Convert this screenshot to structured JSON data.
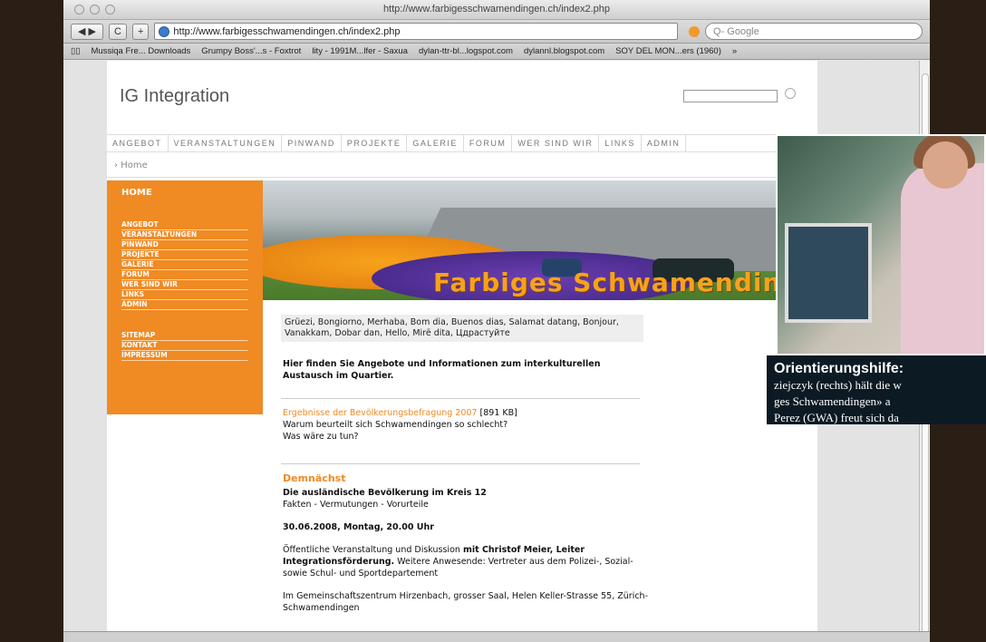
{
  "browser": {
    "window_title": "http://www.farbigesschwamendingen.ch/index2.php",
    "url": "http://www.farbigesschwamendingen.ch/index2.php",
    "search_placeholder": "Q- Google",
    "reload_label": "C",
    "add_label": "+",
    "bookmarks": [
      "Mussiqa Fre... Downloads",
      "Grumpy Boss'...s - Foxtrot",
      "lity - 1991M...lfer - Saxua",
      "dylan-ttr-bl...logspot.com",
      "dylannl.blogspot.com",
      "SOY DEL MON...ers (1960)"
    ],
    "bookmarks_more": "»"
  },
  "site": {
    "logo": "IG Integration",
    "nav": [
      "ANGEBOT",
      "VERANSTALTUNGEN",
      "PINWAND",
      "PROJEKTE",
      "GALERIE",
      "FORUM",
      "WER SIND WIR",
      "LINKS",
      "ADMIN"
    ],
    "breadcrumb": "Home",
    "sidebar_home": "HOME",
    "sidebar_items": [
      "ANGEBOT",
      "VERANSTALTUNGEN",
      "PINWAND",
      "PROJEKTE",
      "GALERIE",
      "FORUM",
      "WER SIND WIR",
      "LINKS",
      "ADMIN"
    ],
    "sidebar_items2": [
      "SITEMAP",
      "KONTAKT",
      "IMPRESSUM"
    ],
    "banner_text": "Farbiges Schwamending",
    "greeting": "Grüezi, Bongiorno, Merhaba, Bom dia, Buenos dias, Salamat datang, Bonjour, Vanakkam, Dobar dan, Hello, Mirë dita, Цдрастуйте",
    "intro": "Hier finden Sie Angebote und Informationen zum interkulturellen Austausch im Quartier.",
    "survey_link": "Ergebnisse der Bevölkerungsbefragung 2007",
    "survey_size": "[891 KB]",
    "survey_q1": "Warum beurteilt sich Schwamendingen so schlecht?",
    "survey_q2": "Was wäre zu tun?",
    "section_title": "Demnächst",
    "event_title": "Die ausländische Bevölkerung im Kreis 12",
    "event_subtitle": "Fakten - Vermutungen - Vorurteile",
    "event_date": "30.06.2008, Montag, 20.00 Uhr",
    "event_desc_pre": "Öffentliche Veranstaltung und Diskussion",
    "event_desc_bold": "mit Christof Meier, Leiter Integrationsförderung.",
    "event_desc_post": "Weitere Anwesende: Vertreter aus dem Polizei-, Sozial- sowie Schul- und Sportdepartement",
    "event_location": "Im Gemeinschaftszentrum Hirzenbach, grosser Saal, Helen Keller-Strasse 55, Zürich-Schwamendingen"
  },
  "caption": {
    "head": "Orientierungshilfe:",
    "line1": "ziejczyk (rechts) hält die w",
    "line2": "ges Schwamendingen» a",
    "line3": "Perez (GWA) freut sich da"
  },
  "colors": {
    "accent": "#f08a23",
    "caption_bg": "#0c1a24"
  }
}
